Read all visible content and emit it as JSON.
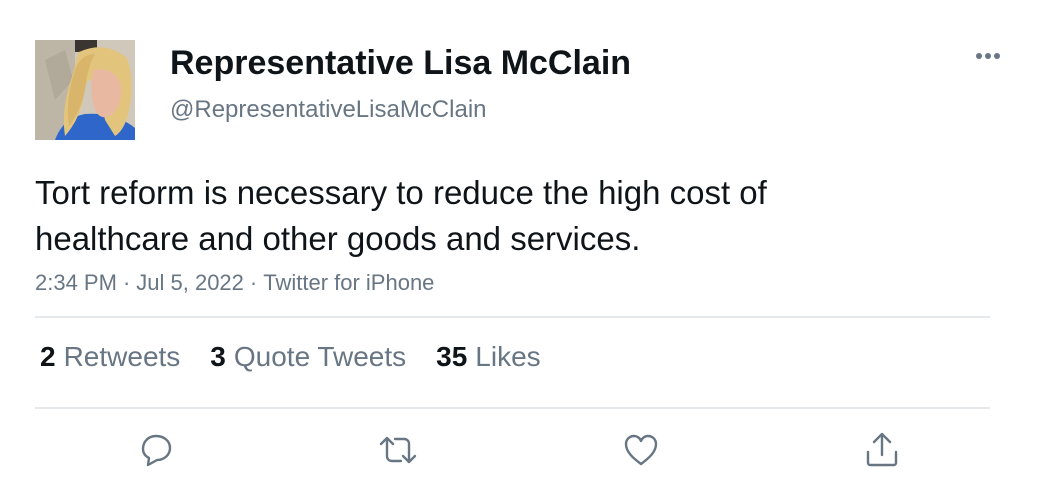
{
  "author": {
    "display_name": "Representative Lisa McClain",
    "handle": "@RepresentativeLisaMcClain",
    "avatar_icon": "profile-photo"
  },
  "tweet": {
    "text_lines": [
      "Tort reform is necessary to reduce the high cost of",
      "healthcare and other goods and services."
    ],
    "time": "2:34 PM",
    "date": "Jul 5, 2022",
    "source": "Twitter for iPhone",
    "separator": "·"
  },
  "stats": {
    "retweets": {
      "count": "2",
      "label": "Retweets"
    },
    "quotes": {
      "count": "3",
      "label": "Quote Tweets"
    },
    "likes": {
      "count": "35",
      "label": "Likes"
    }
  },
  "actions": [
    {
      "name": "reply",
      "icon": "reply-icon"
    },
    {
      "name": "retweet",
      "icon": "retweet-icon"
    },
    {
      "name": "like",
      "icon": "heart-icon"
    },
    {
      "name": "share",
      "icon": "share-icon"
    }
  ],
  "colors": {
    "text_primary": "#0f1419",
    "text_secondary": "#687684",
    "divider": "#e6e9eb"
  }
}
